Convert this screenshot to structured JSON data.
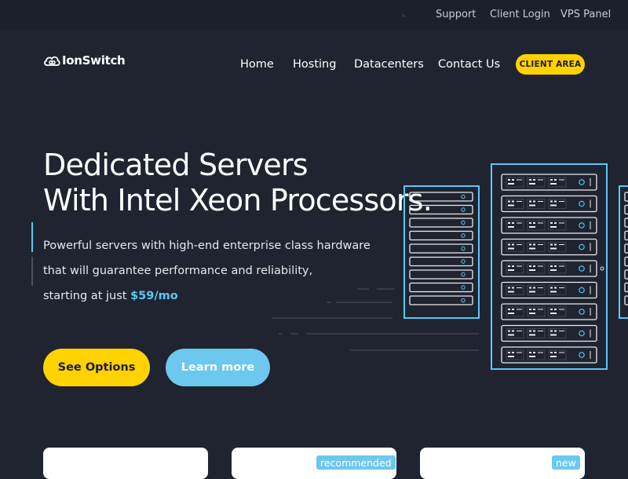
{
  "topbar": {
    "links": [
      "Support",
      "Client Login",
      "VPS Panel"
    ]
  },
  "brand": {
    "name": "IonSwitch"
  },
  "nav": {
    "items": [
      "Home",
      "Hosting",
      "Datacenters",
      "Contact Us"
    ],
    "client_area": "CLIENT AREA"
  },
  "hero": {
    "title_line1": "Dedicated Servers",
    "title_line2": "With Intel Xeon Processors.",
    "desc_line1": "Powerful servers with high-end enterprise class hardware",
    "desc_line2": "that will guarantee performance and reliability,",
    "desc_line3_prefix": "starting at just ",
    "price": "$59/mo",
    "primary_button": "See Options",
    "secondary_button": "Learn more"
  },
  "cards": {
    "badges": [
      "recommended",
      "new"
    ]
  },
  "colors": {
    "background": "#1f2430",
    "topbar": "#1b212b",
    "accent_yellow": "#ffd200",
    "accent_blue": "#5ac8f5",
    "button_blue": "#6cc8ef"
  },
  "icons": [
    "logo-cloud-icon",
    "server-rack-illustration"
  ]
}
